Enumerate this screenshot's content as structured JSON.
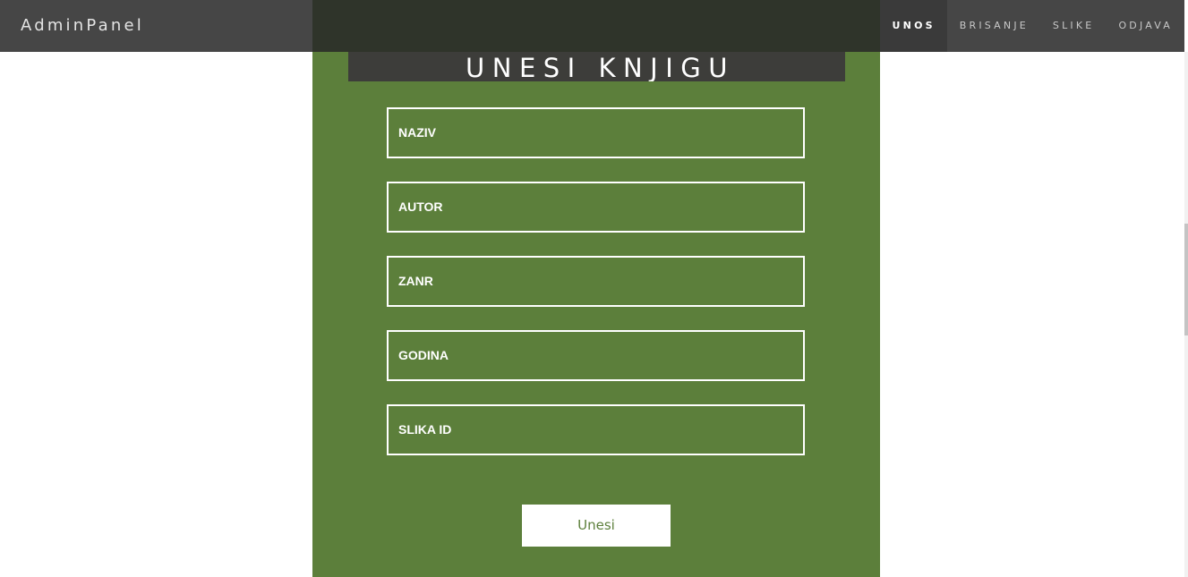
{
  "navbar": {
    "brand": "AdminPanel",
    "links": [
      {
        "label": "UNOS",
        "active": true
      },
      {
        "label": "BRISANJE",
        "active": false
      },
      {
        "label": "SLIKE",
        "active": false
      },
      {
        "label": "ODJAVA",
        "active": false
      }
    ]
  },
  "form": {
    "title": "UNESI KNJIGU",
    "fields": [
      {
        "placeholder": "NAZIV",
        "value": ""
      },
      {
        "placeholder": "AUTOR",
        "value": ""
      },
      {
        "placeholder": "ZANR",
        "value": ""
      },
      {
        "placeholder": "GODINA",
        "value": ""
      },
      {
        "placeholder": "SLIKA ID",
        "value": ""
      }
    ],
    "submit_label": "Unesi"
  },
  "colors": {
    "panel_green": "#5c7f3b",
    "navbar_bg": "#282828",
    "heading_bg": "#3d3d3a",
    "text_white": "#ffffff"
  }
}
